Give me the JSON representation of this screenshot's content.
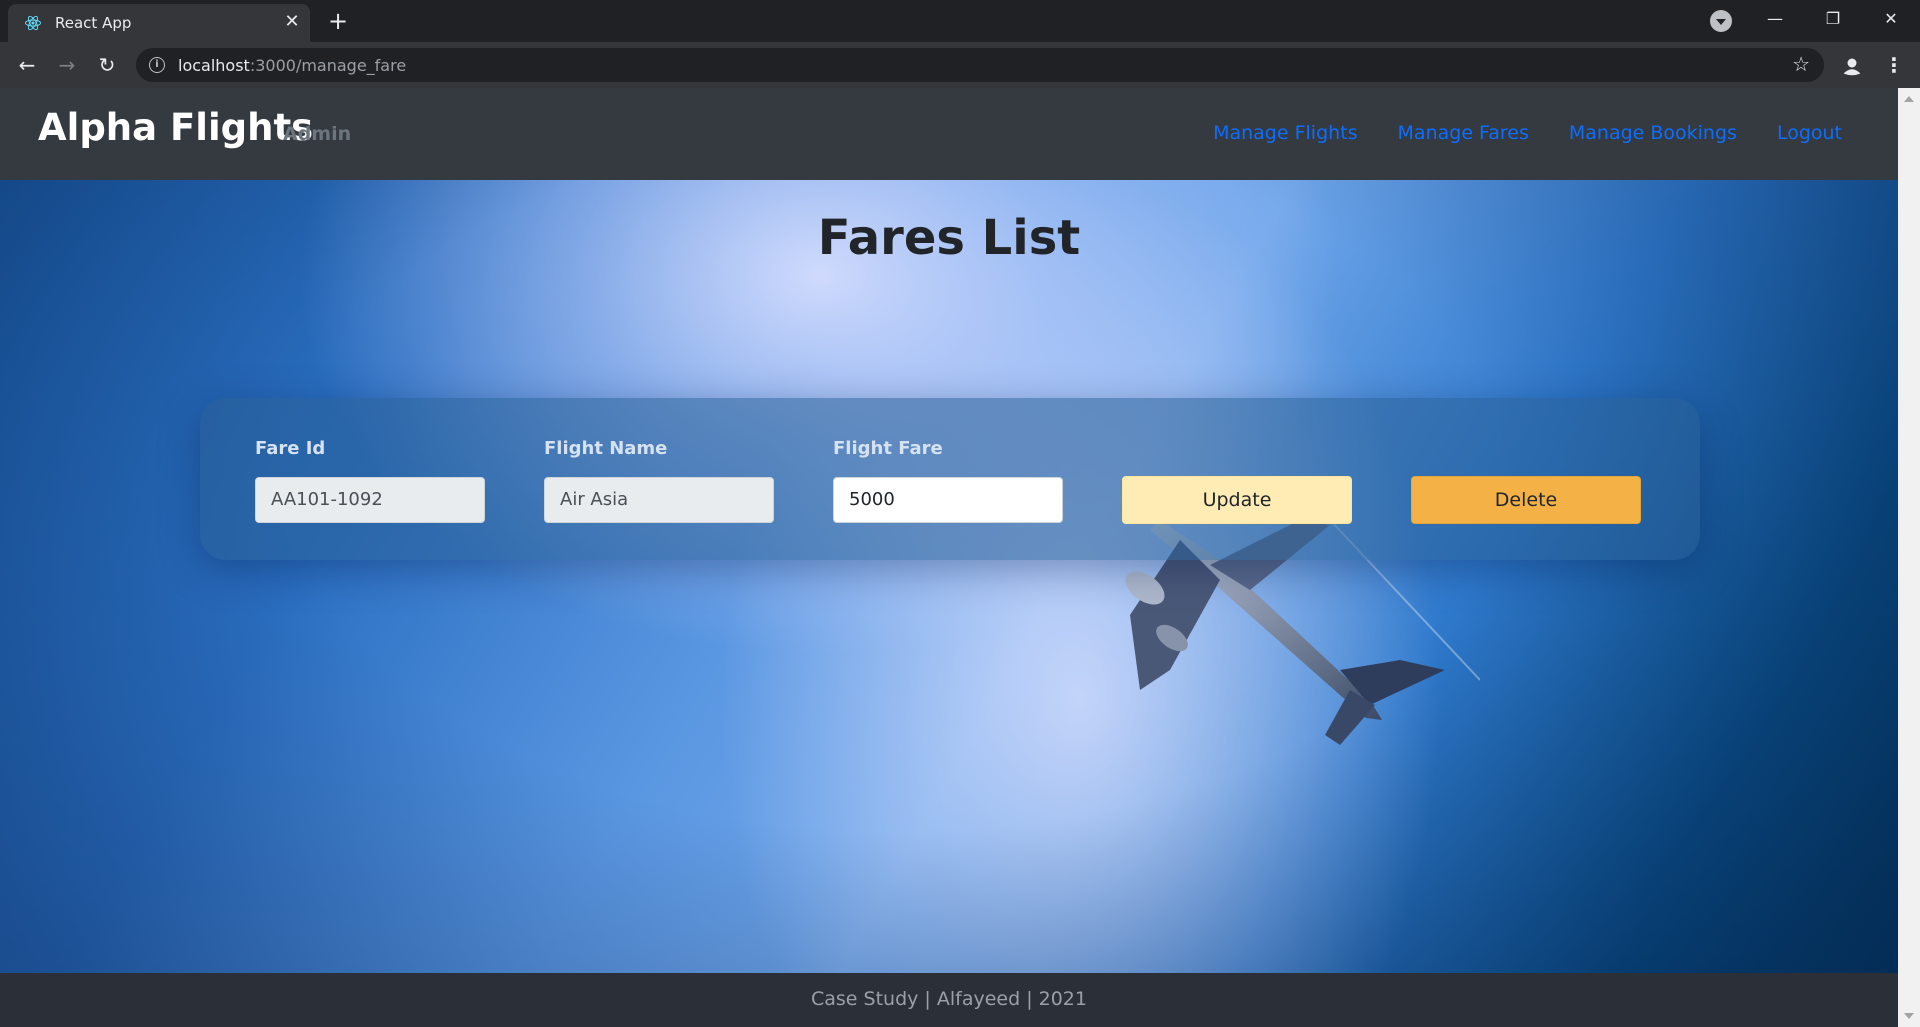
{
  "browser": {
    "tab_title": "React App",
    "url_host": "localhost",
    "url_path": ":3000/manage_fare",
    "icons": {
      "favicon": "react-icon",
      "close": "close-icon",
      "new_tab": "plus-icon",
      "back": "arrow-left-icon",
      "forward": "arrow-right-icon",
      "reload": "reload-icon",
      "site_info": "info-icon",
      "bookmark": "star-icon",
      "profile": "person-icon",
      "menu": "kebab-menu-icon"
    }
  },
  "navbar": {
    "brand": "Alpha Flights",
    "brand_sub": "Admin",
    "links": [
      "Manage Flights",
      "Manage Fares",
      "Manage Bookings",
      "Logout"
    ],
    "link_color": "#0d6efd"
  },
  "page": {
    "title": "Fares List",
    "fare_row": {
      "fare_id_label": "Fare Id",
      "fare_id_value": "AA101-1092",
      "flight_name_label": "Flight Name",
      "flight_name_value": "Air Asia",
      "flight_fare_label": "Flight Fare",
      "flight_fare_value": "5000",
      "update_label": "Update",
      "delete_label": "Delete"
    }
  },
  "footer": {
    "text": "Case Study | Alfayeed | 2021"
  },
  "colors": {
    "navbar_bg": "#343a40",
    "update_btn": "#ffecb5",
    "delete_btn": "#f4b246"
  }
}
